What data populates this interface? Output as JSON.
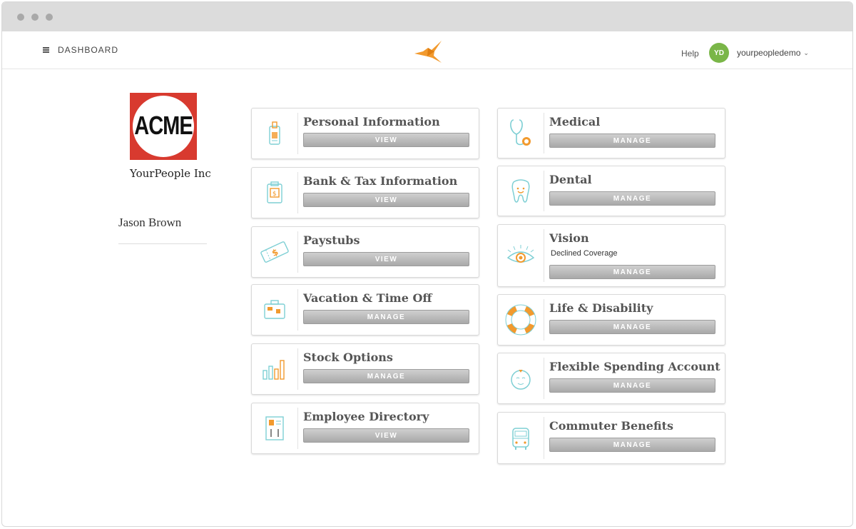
{
  "window": {
    "dots": 3
  },
  "nav": {
    "menu_label": "DASHBOARD",
    "help_label": "Help",
    "avatar_initials": "YD",
    "username": "yourpeopledemo"
  },
  "company": {
    "logo_text": "ACME",
    "name": "YourPeople Inc"
  },
  "user": {
    "name": "Jason Brown"
  },
  "colors": {
    "accent_orange": "#f29a2e",
    "teal": "#7ecfd4",
    "avatar_green": "#7ab648",
    "logo_red": "#d83a2f"
  },
  "left_cards": [
    {
      "title": "Personal Information",
      "action": "VIEW",
      "icon": "id-badge-icon"
    },
    {
      "title": "Bank & Tax Information",
      "action": "VIEW",
      "icon": "clipboard-dollar-icon"
    },
    {
      "title": "Paystubs",
      "action": "VIEW",
      "icon": "ticket-dollar-icon"
    },
    {
      "title": "Vacation & Time Off",
      "action": "MANAGE",
      "icon": "suitcase-icon"
    },
    {
      "title": "Stock Options",
      "action": "MANAGE",
      "icon": "bar-chart-icon"
    },
    {
      "title": "Employee Directory",
      "action": "VIEW",
      "icon": "directory-icon"
    }
  ],
  "right_cards": [
    {
      "title": "Medical",
      "action": "MANAGE",
      "icon": "stethoscope-icon"
    },
    {
      "title": "Dental",
      "action": "MANAGE",
      "icon": "tooth-icon"
    },
    {
      "title": "Vision",
      "note": "Declined Coverage",
      "action": "MANAGE",
      "icon": "eye-icon"
    },
    {
      "title": "Life & Disability",
      "action": "MANAGE",
      "icon": "life-ring-icon"
    },
    {
      "title": "Flexible Spending Account",
      "action": "MANAGE",
      "icon": "baby-icon"
    },
    {
      "title": "Commuter Benefits",
      "action": "MANAGE",
      "icon": "bus-icon"
    }
  ]
}
